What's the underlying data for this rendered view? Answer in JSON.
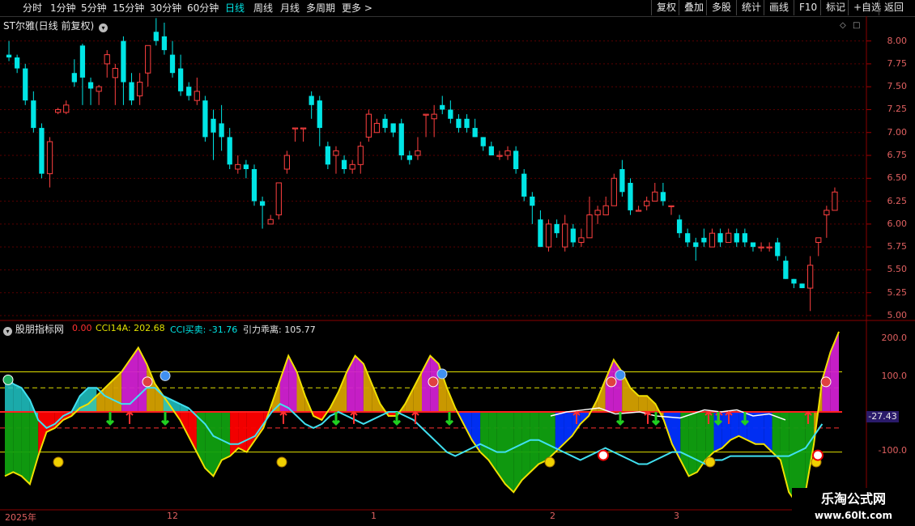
{
  "toolbar": {
    "periods": [
      "分时",
      "1分钟",
      "5分钟",
      "15分钟",
      "30分钟",
      "60分钟",
      "日线",
      "周线",
      "月线",
      "多周期",
      "更多"
    ],
    "active_index": 6,
    "more_chevron": ">",
    "right_buttons": [
      "复权",
      "叠加",
      "多股",
      "统计",
      "画线",
      "F10",
      "标记",
      "+自选",
      "返回"
    ]
  },
  "price_panel": {
    "title": "ST尔雅(日线 前复权)",
    "axis_ticks": [
      "8.00",
      "7.75",
      "7.50",
      "7.25",
      "7.00",
      "6.75",
      "6.50",
      "6.25",
      "6.00",
      "5.75",
      "5.50",
      "5.25",
      "5.00"
    ],
    "tick_values": [
      8.0,
      7.75,
      7.5,
      7.25,
      7.0,
      6.75,
      6.5,
      6.25,
      6.0,
      5.75,
      5.5,
      5.25,
      5.0
    ],
    "colors": {
      "up": "#ff4040",
      "down": "#00e5e5",
      "grid": "#5a0000"
    }
  },
  "indicator_panel": {
    "title": "股朋指标网",
    "values": [
      {
        "label": "0.00",
        "color": "#ff3030"
      },
      {
        "label": "CCI14A: 202.68",
        "color": "#e0e000"
      },
      {
        "label": "CCI买卖: -31.76",
        "color": "#00e5e5"
      },
      {
        "label": "引力乖离: 105.77",
        "color": "#e6e6e6"
      }
    ],
    "axis_ticks": [
      "200.0",
      "100.0",
      "-100.0"
    ],
    "current_badge": "-27.43",
    "colors": {
      "yellow": "#d4a000",
      "magenta": "#d020d0",
      "red": "#ff0000",
      "cyan": "#20c8c8",
      "green": "#10a010",
      "blue": "#0030ff",
      "line_cyan": "#40e0f0",
      "line_white": "#ffffff"
    }
  },
  "date_axis": [
    "2025年",
    "12",
    "1",
    "2",
    "3"
  ],
  "watermark": {
    "name": "乐淘公式网",
    "url": "www.60lt.com"
  },
  "chart_data": {
    "type": "candlestick",
    "title": "ST尔雅(日线 前复权)",
    "ylim": [
      5.0,
      8.2
    ],
    "candles": [
      [
        7.85,
        7.82,
        8.0,
        7.78
      ],
      [
        7.82,
        7.7,
        7.85,
        7.65
      ],
      [
        7.7,
        7.35,
        7.75,
        7.3
      ],
      [
        7.35,
        7.05,
        7.45,
        7.0
      ],
      [
        7.05,
        6.55,
        7.1,
        6.5
      ],
      [
        6.55,
        6.9,
        6.95,
        6.4
      ],
      [
        7.22,
        7.25,
        7.27,
        7.2
      ],
      [
        7.22,
        7.3,
        7.35,
        7.2
      ],
      [
        7.65,
        7.55,
        7.8,
        7.5
      ],
      [
        7.95,
        7.6,
        7.97,
        7.3
      ],
      [
        7.55,
        7.48,
        7.6,
        7.3
      ],
      [
        7.45,
        7.5,
        7.52,
        7.3
      ],
      [
        7.75,
        7.85,
        7.9,
        7.6
      ],
      [
        7.6,
        7.7,
        7.75,
        7.3
      ],
      [
        8.0,
        7.55,
        8.05,
        7.3
      ],
      [
        7.55,
        7.35,
        7.65,
        7.3
      ],
      [
        7.4,
        7.55,
        7.65,
        7.3
      ],
      [
        7.65,
        7.95,
        7.95,
        7.5
      ],
      [
        8.1,
        8.0,
        8.25,
        7.95
      ],
      [
        8.05,
        7.9,
        8.2,
        7.85
      ],
      [
        7.85,
        7.65,
        8.0,
        7.6
      ],
      [
        7.7,
        7.45,
        7.85,
        7.4
      ],
      [
        7.5,
        7.4,
        7.55,
        7.35
      ],
      [
        7.35,
        7.45,
        7.6,
        7.3
      ],
      [
        7.35,
        6.95,
        7.4,
        6.9
      ],
      [
        7.15,
        7.0,
        7.25,
        6.7
      ],
      [
        7.1,
        6.95,
        7.3,
        6.8
      ],
      [
        6.95,
        6.65,
        7.05,
        6.6
      ],
      [
        6.6,
        6.65,
        6.75,
        6.55
      ],
      [
        6.65,
        6.6,
        6.7,
        6.5
      ],
      [
        6.6,
        6.25,
        6.65,
        6.2
      ],
      [
        6.25,
        6.2,
        6.3,
        5.95
      ],
      [
        6.0,
        6.05,
        6.1,
        6.0
      ],
      [
        6.1,
        6.45,
        6.45,
        6.05
      ],
      [
        6.6,
        6.75,
        6.8,
        6.55
      ],
      [
        7.05,
        7.05,
        7.05,
        6.9
      ],
      [
        7.05,
        7.05,
        7.05,
        6.9
      ],
      [
        7.4,
        7.3,
        7.45,
        7.15
      ],
      [
        7.35,
        7.05,
        7.4,
        6.85
      ],
      [
        6.85,
        6.65,
        6.9,
        6.6
      ],
      [
        6.75,
        6.8,
        6.85,
        6.55
      ],
      [
        6.7,
        6.6,
        6.75,
        6.55
      ],
      [
        6.6,
        6.65,
        6.7,
        6.55
      ],
      [
        6.65,
        6.85,
        6.9,
        6.55
      ],
      [
        6.95,
        7.2,
        7.25,
        6.9
      ],
      [
        7.0,
        7.1,
        7.15,
        7.0
      ],
      [
        7.15,
        7.05,
        7.2,
        7.0
      ],
      [
        7.1,
        7.0,
        7.1,
        6.95
      ],
      [
        7.1,
        6.75,
        7.15,
        6.7
      ],
      [
        6.75,
        6.7,
        6.8,
        6.65
      ],
      [
        6.75,
        6.8,
        6.95,
        6.7
      ],
      [
        7.2,
        7.2,
        7.2,
        6.95
      ],
      [
        7.15,
        7.2,
        7.3,
        6.95
      ],
      [
        7.3,
        7.25,
        7.4,
        7.2
      ],
      [
        7.25,
        7.15,
        7.35,
        7.1
      ],
      [
        7.15,
        7.05,
        7.2,
        7.0
      ],
      [
        7.15,
        7.05,
        7.2,
        7.0
      ],
      [
        7.05,
        6.95,
        7.15,
        6.95
      ],
      [
        6.95,
        6.85,
        6.95,
        6.8
      ],
      [
        6.85,
        6.75,
        6.9,
        6.75
      ],
      [
        6.75,
        6.75,
        6.8,
        6.7
      ],
      [
        6.75,
        6.8,
        6.85,
        6.7
      ],
      [
        6.8,
        6.6,
        6.85,
        6.55
      ],
      [
        6.55,
        6.3,
        6.6,
        6.25
      ],
      [
        6.3,
        6.2,
        6.35,
        6.0
      ],
      [
        6.05,
        5.75,
        6.15,
        5.75
      ],
      [
        5.75,
        6.0,
        6.05,
        5.7
      ],
      [
        6.0,
        5.9,
        6.05,
        5.85
      ],
      [
        5.75,
        6.0,
        6.1,
        5.7
      ],
      [
        5.95,
        5.8,
        6.0,
        5.75
      ],
      [
        5.8,
        5.85,
        5.95,
        5.75
      ],
      [
        5.85,
        6.1,
        6.3,
        5.85
      ],
      [
        6.1,
        6.15,
        6.2,
        6.0
      ],
      [
        6.1,
        6.2,
        6.3,
        6.1
      ],
      [
        6.2,
        6.5,
        6.55,
        6.2
      ],
      [
        6.6,
        6.35,
        6.7,
        6.3
      ],
      [
        6.45,
        6.15,
        6.5,
        6.1
      ],
      [
        6.15,
        6.15,
        6.2,
        6.15
      ],
      [
        6.2,
        6.25,
        6.3,
        6.15
      ],
      [
        6.25,
        6.35,
        6.45,
        6.25
      ],
      [
        6.35,
        6.25,
        6.45,
        6.2
      ],
      [
        6.2,
        6.2,
        6.2,
        6.1
      ],
      [
        6.05,
        5.9,
        6.1,
        5.85
      ],
      [
        5.9,
        5.8,
        5.95,
        5.75
      ],
      [
        5.8,
        5.75,
        5.85,
        5.6
      ],
      [
        5.85,
        5.8,
        5.95,
        5.75
      ],
      [
        5.75,
        5.9,
        5.95,
        5.75
      ],
      [
        5.9,
        5.8,
        5.95,
        5.75
      ],
      [
        5.8,
        5.9,
        5.95,
        5.8
      ],
      [
        5.9,
        5.8,
        5.95,
        5.75
      ],
      [
        5.9,
        5.8,
        5.95,
        5.75
      ],
      [
        5.8,
        5.75,
        5.8,
        5.7
      ],
      [
        5.75,
        5.75,
        5.8,
        5.7
      ],
      [
        5.75,
        5.75,
        5.8,
        5.7
      ],
      [
        5.8,
        5.65,
        5.85,
        5.6
      ],
      [
        5.6,
        5.4,
        5.65,
        5.4
      ],
      [
        5.4,
        5.35,
        5.4,
        5.3
      ],
      [
        5.35,
        5.3,
        5.35,
        5.3
      ],
      [
        5.3,
        5.55,
        5.65,
        5.05
      ],
      [
        5.8,
        5.85,
        5.85,
        5.65
      ],
      [
        6.1,
        6.15,
        6.2,
        5.85
      ],
      [
        6.15,
        6.35,
        6.4,
        6.15
      ]
    ],
    "indicator": {
      "ylim": [
        -240,
        220
      ],
      "levels": {
        "upper": 100,
        "dash_upper": 60,
        "zero": 0,
        "dash_lower": -40,
        "lower": -100
      },
      "cci14a": [
        -160,
        -150,
        -160,
        -180,
        -110,
        -50,
        -40,
        -20,
        -10,
        10,
        20,
        40,
        60,
        80,
        100,
        130,
        160,
        120,
        70,
        40,
        10,
        -20,
        -60,
        -100,
        -140,
        -160,
        -120,
        -110,
        -90,
        -100,
        -70,
        -40,
        20,
        80,
        140,
        100,
        40,
        -10,
        -20,
        10,
        50,
        100,
        140,
        120,
        70,
        20,
        -10,
        -10,
        20,
        60,
        100,
        140,
        120,
        60,
        10,
        -30,
        -70,
        -100,
        -120,
        -150,
        -180,
        -200,
        -170,
        -150,
        -130,
        -120,
        -100,
        -80,
        -60,
        -30,
        -10,
        30,
        80,
        130,
        100,
        60,
        40,
        40,
        20,
        -20,
        -80,
        -120,
        -160,
        -150,
        -120,
        -100,
        -90,
        -70,
        -60,
        -70,
        -80,
        -80,
        -100,
        -120,
        -200,
        -230,
        -200,
        -80,
        80,
        150,
        200
      ],
      "cci_trade": [
        90,
        70,
        60,
        30,
        -20,
        -40,
        -30,
        -10,
        0,
        40,
        60,
        60,
        40,
        30,
        20,
        20,
        40,
        60,
        60,
        40,
        30,
        20,
        10,
        -10,
        -30,
        -60,
        -70,
        -80,
        -80,
        -70,
        -60,
        -30,
        0,
        20,
        10,
        -10,
        -30,
        -40,
        -30,
        -10,
        0,
        -10,
        -20,
        -30,
        -20,
        -10,
        0,
        0,
        -10,
        -20,
        -40,
        -60,
        -80,
        -100,
        -110,
        -100,
        -90,
        -80,
        -90,
        -100,
        -100,
        -90,
        -80,
        -70,
        -70,
        -80,
        -90,
        -100,
        -110,
        -120,
        -110,
        -100,
        -90,
        -100,
        -110,
        -120,
        -130,
        -130,
        -120,
        -110,
        -100,
        -100,
        -110,
        -120,
        -130,
        -120,
        -120,
        -110,
        -110,
        -110,
        -110,
        -110,
        -110,
        -110,
        -110,
        -100,
        -90,
        -60,
        -30
      ]
    }
  }
}
